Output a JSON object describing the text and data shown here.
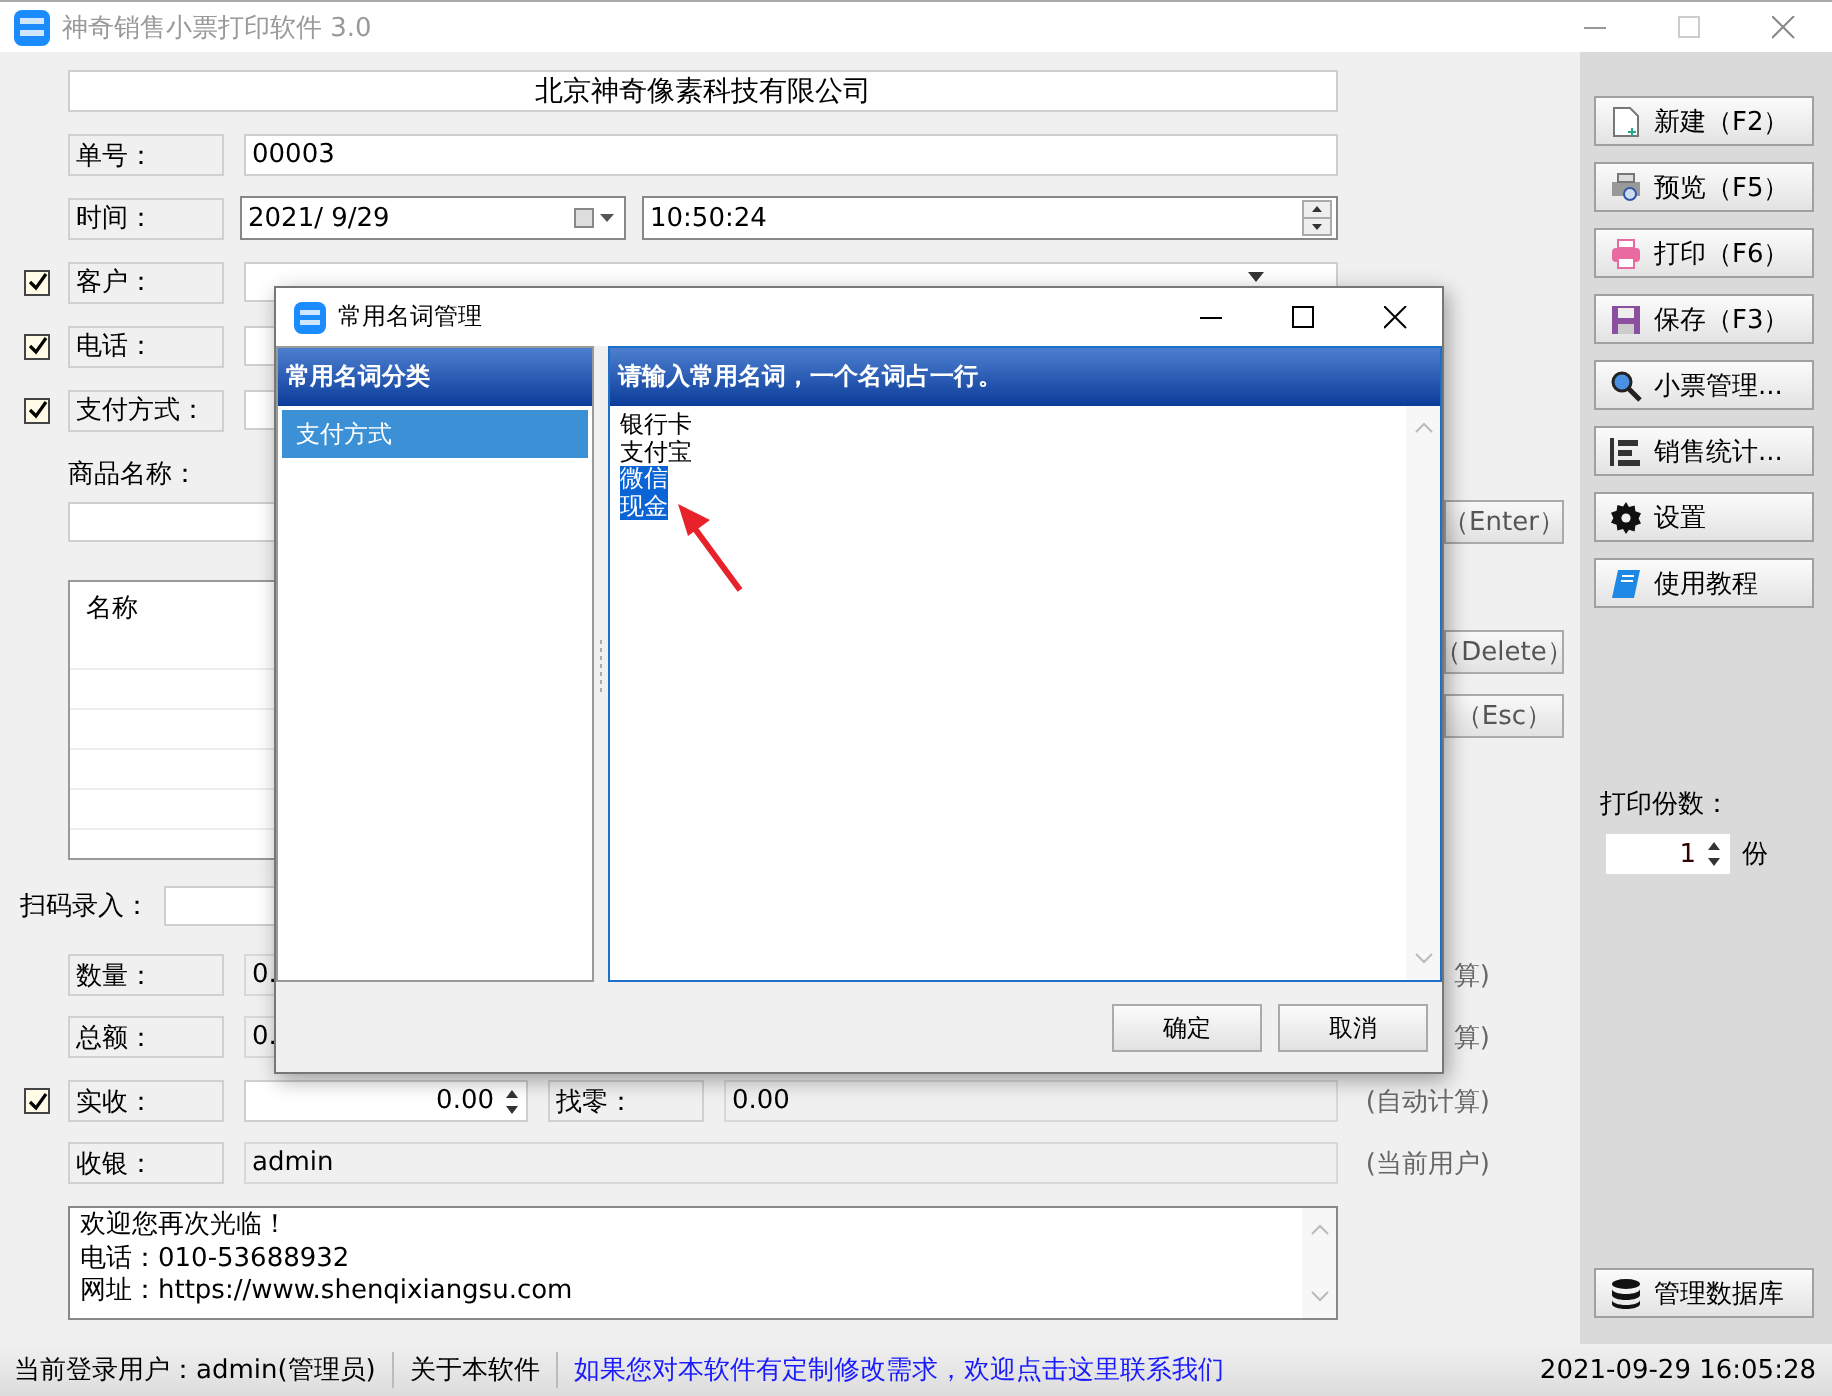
{
  "window": {
    "title": "神奇销售小票打印软件 3.0"
  },
  "form": {
    "company": "北京神奇像素科技有限公司",
    "order_no": {
      "label": "单号：",
      "value": "00003"
    },
    "time": {
      "label": "时间：",
      "date": "2021/  9/29",
      "time": "10:50:24"
    },
    "options": [
      {
        "label": "客户：",
        "checked": true,
        "kind": "combo"
      },
      {
        "label": "电话：",
        "checked": true,
        "kind": "text"
      },
      {
        "label": "支付方式：",
        "checked": true,
        "kind": "text"
      }
    ],
    "goods_label": "商品名称：",
    "goods_buttons": [
      "（Enter）",
      "（Delete）",
      "（Esc）"
    ],
    "table": {
      "columns": [
        "名称"
      ]
    },
    "scan_label": "扫码录入：",
    "totals": [
      {
        "label": "数量：",
        "value": "0.",
        "note": "算)"
      },
      {
        "label": "总额：",
        "value": "0.",
        "note": "算)"
      }
    ],
    "received": {
      "label": "实收：",
      "checked": true,
      "value": "0.00",
      "change_label": "找零：",
      "change": "0.00",
      "note": "(自动计算)"
    },
    "cashier": {
      "label": "收银：",
      "value": "admin",
      "note": "(当前用户)"
    },
    "footer_lines": [
      "欢迎您再次光临！",
      "电话：010-53688932",
      "网址：https://www.shenqixiangsu.com"
    ]
  },
  "sidebar": {
    "buttons": [
      {
        "label": "新建（F2）",
        "kind": "new"
      },
      {
        "label": "预览（F5）",
        "kind": "preview"
      },
      {
        "label": "打印（F6）",
        "kind": "print"
      },
      {
        "label": "保存（F3）",
        "kind": "save"
      },
      {
        "label": "小票管理...",
        "kind": "search"
      },
      {
        "label": "销售统计...",
        "kind": "stats"
      },
      {
        "label": "设置",
        "kind": "settings"
      },
      {
        "label": "使用教程",
        "kind": "book"
      }
    ],
    "copies_label": "打印份数：",
    "copies": "1",
    "copies_unit": "份",
    "db_button": "管理数据库"
  },
  "dialog": {
    "title": "常用名词管理",
    "category_header": "常用名词分类",
    "categories": [
      {
        "label": "支付方式",
        "selected": true
      }
    ],
    "terms_header": "请输入常用名词，一个名词占一行。",
    "terms": [
      {
        "text": "银行卡",
        "selected": false
      },
      {
        "text": "支付宝",
        "selected": false
      },
      {
        "text": "微信",
        "selected": true
      },
      {
        "text": "现金",
        "selected": true
      }
    ],
    "buttons": [
      "确定",
      "取消"
    ]
  },
  "status_bar": {
    "user": "当前登录用户：admin(管理员)",
    "about": "关于本软件",
    "link": "如果您对本软件有定制修改需求，欢迎点击这里联系我们",
    "datetime": "2021-09-29 16:05:28"
  }
}
